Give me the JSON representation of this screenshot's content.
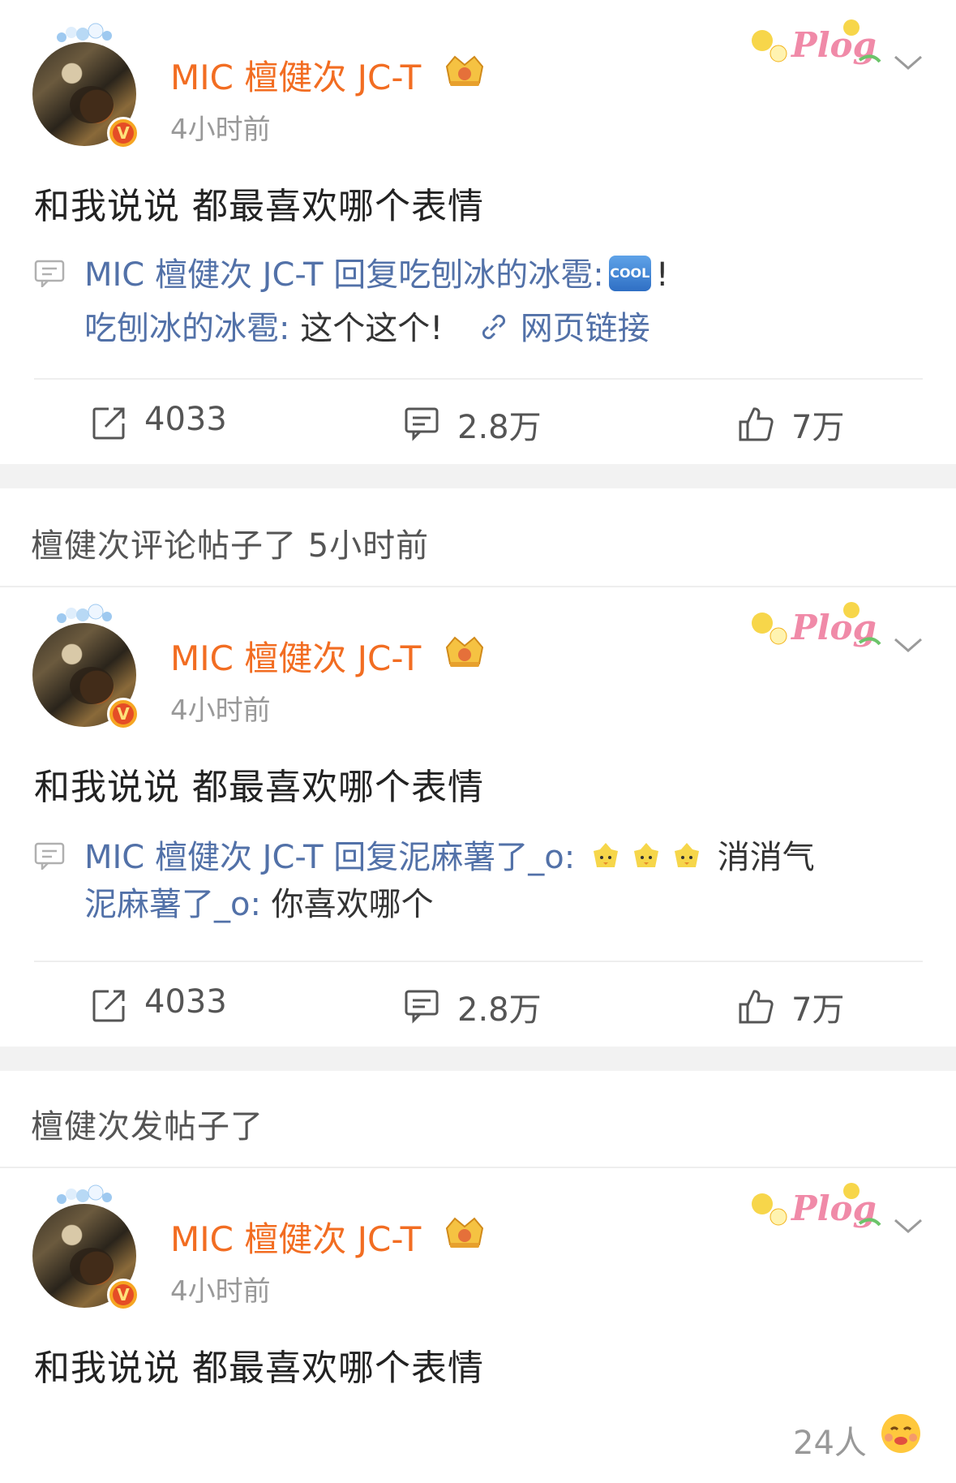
{
  "posts": [
    {
      "author": "MIC 檀健次 JC-T",
      "time": "4小时前",
      "content": "和我说说 都最喜欢哪个表情",
      "reply": {
        "line1_prefix": "MIC 檀健次 JC-T 回复吃刨冰的冰雹:",
        "line1_emoji": "COOL",
        "line1_suffix": "!",
        "line2_user": "吃刨冰的冰雹:",
        "line2_text": "这个这个!",
        "link_label": "网页链接"
      },
      "actions": {
        "repost": "4033",
        "comment": "2.8万",
        "like": "7万"
      }
    },
    {
      "section_header": "檀健次评论帖子了 5小时前",
      "author": "MIC 檀健次 JC-T",
      "time": "4小时前",
      "content": "和我说说 都最喜欢哪个表情",
      "reply": {
        "line1_prefix": "MIC 檀健次 JC-T 回复泥麻薯了_o:",
        "line1_suffix": "消消气",
        "line2_user": "泥麻薯了_o:",
        "line2_text": "你喜欢哪个"
      },
      "actions": {
        "repost": "4033",
        "comment": "2.8万",
        "like": "7万"
      }
    },
    {
      "section_header": "檀健次发帖子了",
      "author": "MIC 檀健次 JC-T",
      "time": "4小时前",
      "content": "和我说说 都最喜欢哪个表情",
      "reaction_count": "24人"
    }
  ],
  "icons": {
    "repost": "repost-icon",
    "comment": "comment-icon",
    "like": "thumbs-up-icon",
    "reply": "comment-bubble-icon",
    "link": "link-icon",
    "badge": "verified-v-badge-icon",
    "crown": "crown-icon",
    "plog": "plog-sticker-icon",
    "more": "chevron-down-icon",
    "reaction": "hug-face-emoji-icon"
  },
  "colors": {
    "username": "#f26d22",
    "reply_link": "#5271a8",
    "secondary": "#999999",
    "divider": "#eeeeee",
    "gap": "#f2f2f2"
  }
}
